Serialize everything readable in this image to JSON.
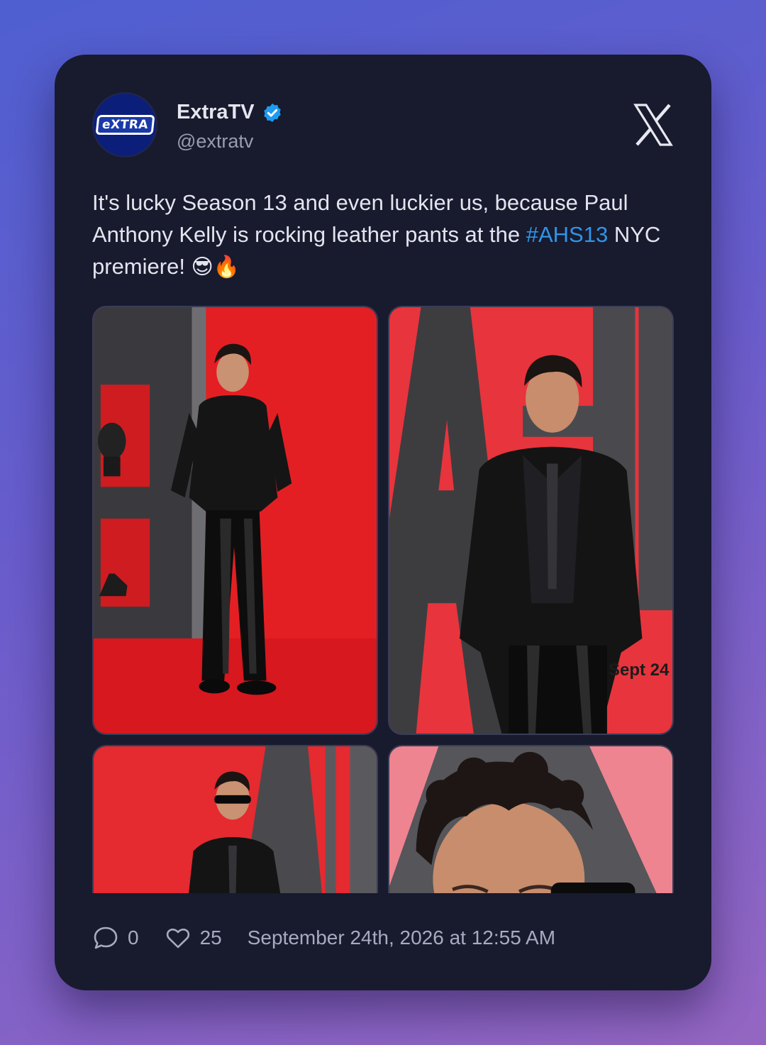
{
  "account": {
    "display_name": "ExtraTV",
    "handle": "@extratv",
    "avatar_text": "eXTRA",
    "verified": true
  },
  "tweet": {
    "text_before": "It's lucky Season 13 and even luckier us, because Paul Anthony Kelly is rocking leather pants at the ",
    "hashtag": "#AHS13",
    "text_after": " NYC premiere! ",
    "emojis": "😎🔥"
  },
  "media": {
    "photo_2_caption": "Sept 24"
  },
  "footer": {
    "replies": "0",
    "likes": "25",
    "timestamp": "September 24th, 2026 at 12:55 AM"
  },
  "icons": {
    "logo": "x-logo-icon",
    "verified": "verified-badge-icon",
    "reply": "speech-bubble-icon",
    "like": "heart-icon"
  },
  "colors": {
    "card_bg": "#181a2e",
    "hashtag": "#2f95e8",
    "verified": "#1d9bf0"
  }
}
